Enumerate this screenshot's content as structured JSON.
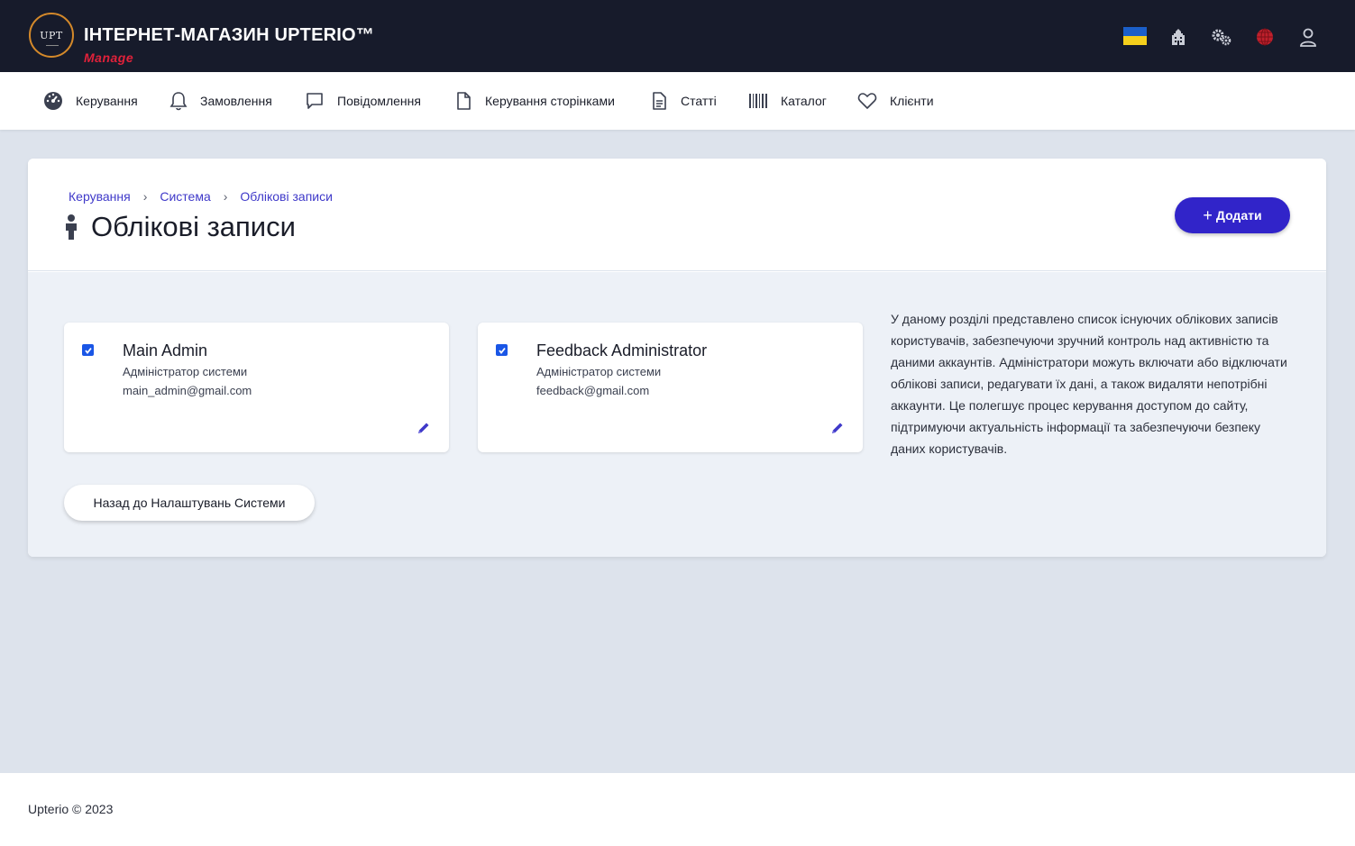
{
  "header": {
    "logo_text": "UPT",
    "title": "ІНТЕРНЕТ-МАГАЗИН UPTERIO™",
    "subtitle": "Manage",
    "icons": [
      "ukraine-flag-icon",
      "building-icon",
      "gears-icon",
      "globe-icon",
      "user-icon"
    ]
  },
  "nav": {
    "items": [
      {
        "label": "Керування",
        "icon": "dashboard-icon"
      },
      {
        "label": "Замовлення",
        "icon": "bell-icon"
      },
      {
        "label": "Повідомлення",
        "icon": "message-icon"
      },
      {
        "label": "Керування сторінками",
        "icon": "page-icon"
      },
      {
        "label": "Статті",
        "icon": "article-icon"
      },
      {
        "label": "Каталог",
        "icon": "barcode-icon"
      },
      {
        "label": "Клієнти",
        "icon": "heart-icon"
      }
    ]
  },
  "breadcrumb": [
    "Керування",
    "Система",
    "Облікові записи"
  ],
  "page": {
    "title": "Облікові записи",
    "add_label": "Додати",
    "description": "У даному розділі представлено список існуючих облікових записів користувачів, забезпечуючи зручний контроль над активністю та даними аккаунтів. Адміністратори можуть включати або відключати облікові записи, редагувати їх дані, а також видаляти непотрібні аккаунти. Це полегшує процес керування доступом до сайту, підтримуючи актуальність інформації та забезпечуючи безпеку даних користувачів.",
    "back_label": "Назад до Налаштувань Системи"
  },
  "accounts": [
    {
      "name": "Main Admin",
      "role": "Адміністратор системи",
      "email": "main_admin@gmail.com",
      "enabled": true
    },
    {
      "name": "Feedback Administrator",
      "role": "Адміністратор системи",
      "email": "feedback@gmail.com",
      "enabled": true
    }
  ],
  "footer": {
    "text": "Upterio © 2023"
  },
  "colors": {
    "topbar": "#171b2b",
    "accent": "#3124c9",
    "link": "#3f39c9",
    "brand_red": "#e0213a",
    "globe_red": "#c0202c"
  }
}
